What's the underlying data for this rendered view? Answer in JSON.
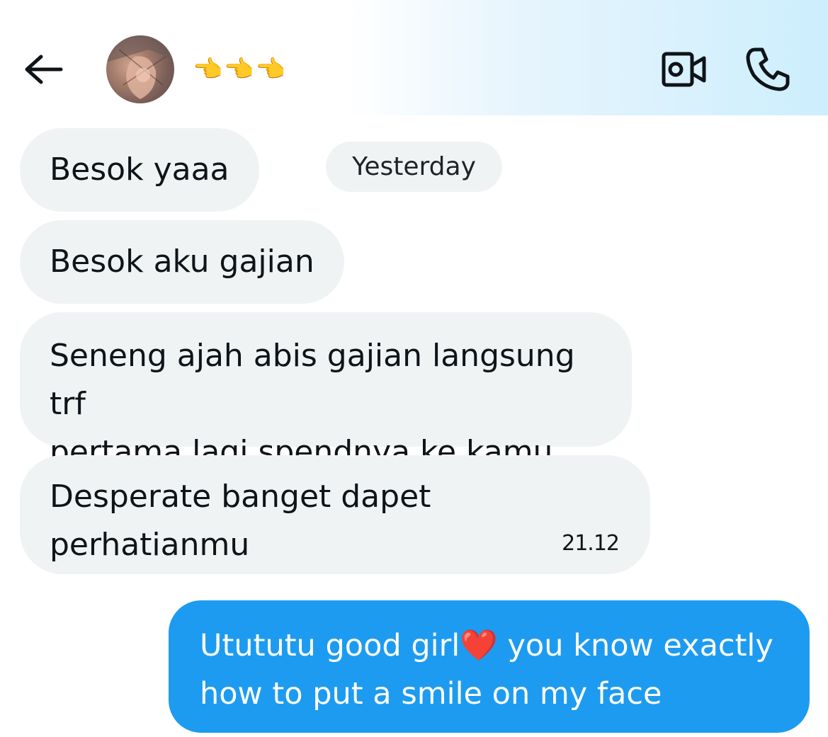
{
  "header": {
    "contact_name": "👈👈👈",
    "back_icon": "arrow-left-icon",
    "video_icon": "video-camera-icon",
    "call_icon": "phone-icon"
  },
  "separator": {
    "label": "Yesterday"
  },
  "messages": {
    "m1": "Besok yaaa",
    "m2": "Besok aku gajian",
    "m3_line1": "Seneng ajah abis gajian langsung trf",
    "m3_line2": "pertama lagi spendnya ke kamu",
    "m4": "Desperate banget dapet perhatianmu",
    "m4_time": "21.12",
    "out_line1_a": "Utututu good girl",
    "out_line1_emoji": "❤️",
    "out_line1_b": " you know exactly",
    "out_line2": "how to put a smile on my face"
  },
  "colors": {
    "incoming_bubble": "#eff3f4",
    "outgoing_bubble": "#1d9bf0",
    "text": "#0f1419"
  }
}
